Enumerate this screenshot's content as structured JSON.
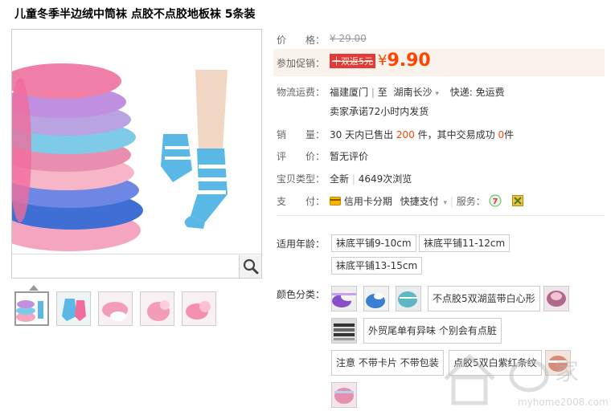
{
  "product": {
    "title": "儿童冬季半边绒中筒袜 点胶不点胶地板袜 5条装"
  },
  "price": {
    "label": "价　　格：",
    "original": "¥ 29.00"
  },
  "promo": {
    "label": "参加促销：",
    "badge": "十双返5元",
    "currency": "¥",
    "price": "9.90"
  },
  "shipping": {
    "label": "物流运费：",
    "from": "福建厦门",
    "to_prefix": "至",
    "to": "湖南长沙",
    "express": "快递: 免运费",
    "promise": "卖家承诺72小时内发货"
  },
  "sales": {
    "label": "销　　量：",
    "prefix": "30 天内已售出",
    "sold": "200",
    "middle": "件，其中交易成功",
    "success": "0",
    "suffix": "件"
  },
  "review": {
    "label": "评　　价：",
    "value": "暂无评价"
  },
  "type": {
    "label": "宝贝类型：",
    "condition": "全新",
    "views": "4649次浏览"
  },
  "payment": {
    "label": "支　　付：",
    "credit": "信用卡分期",
    "quick": "快捷支付",
    "service_label": "服务："
  },
  "age": {
    "label": "适用年龄：",
    "options": [
      "袜底平铺9-10cm",
      "袜底平铺11-12cm",
      "袜底平铺13-15cm"
    ]
  },
  "color": {
    "label": "颜色分类：",
    "options": [
      "不点胶5双湖蓝带白心形",
      "外贸尾单有异味 个别会有点脏",
      "注意 不带卡片 不带包装",
      "点胶5双白紫红条纹"
    ]
  },
  "watermark": {
    "text": "家",
    "url": "myhome2008.com"
  },
  "icons": [
    "search-icon",
    "credit-card-icon",
    "dropdown-arrow-icon",
    "seven-day-return-icon",
    "certified-icon"
  ],
  "colors": {
    "accent": "#ff4400",
    "promo_bg": "#f9f3eb",
    "badge": "#e4393c"
  }
}
